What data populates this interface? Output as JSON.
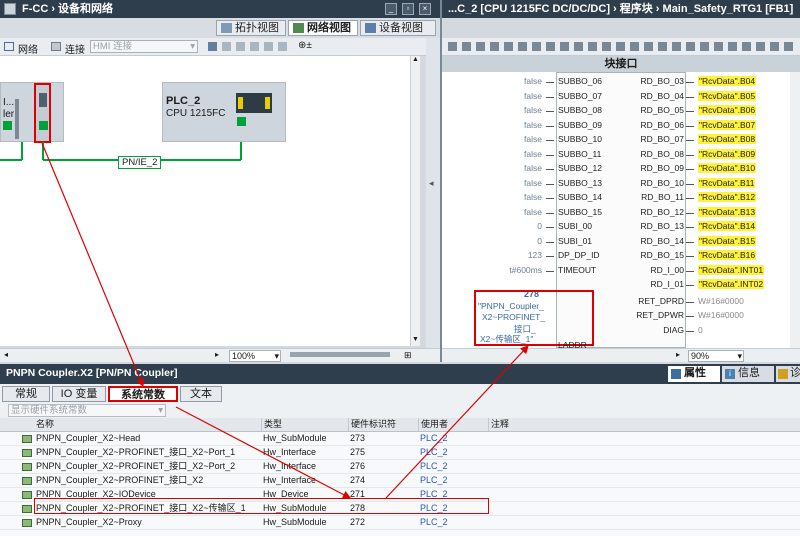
{
  "left_window": {
    "title": "F-CC  ›  设备和网络",
    "tabs": [
      "拓扑视图",
      "网络视图",
      "设备视图"
    ],
    "active_tab": "网络视图",
    "toolbar": {
      "network_label": "网络",
      "connect_label": "连接",
      "hmi_connect_placeholder": "HMI 连接"
    },
    "device_left": {
      "name_fragment": "I...",
      "type_fragment": "ler"
    },
    "device_plc": {
      "name": "PLC_2",
      "type": "CPU 1215FC"
    },
    "network_label": "PN/IE_2",
    "zoom": "100%"
  },
  "right_window": {
    "title": "...C_2 [CPU 1215FC DC/DC/DC]  ›  程序块  ›  Main_Safety_RTG1 [FB1]",
    "section_header": "块接口",
    "inputs": [
      {
        "value": "false",
        "pin": "SUBBO_06"
      },
      {
        "value": "false",
        "pin": "SUBBO_07"
      },
      {
        "value": "false",
        "pin": "SUBBO_08"
      },
      {
        "value": "false",
        "pin": "SUBBO_09"
      },
      {
        "value": "false",
        "pin": "SUBBO_10"
      },
      {
        "value": "false",
        "pin": "SUBBO_11"
      },
      {
        "value": "false",
        "pin": "SUBBO_12"
      },
      {
        "value": "false",
        "pin": "SUBBO_13"
      },
      {
        "value": "false",
        "pin": "SUBBO_14"
      },
      {
        "value": "false",
        "pin": "SUBBO_15"
      },
      {
        "value": "0",
        "pin": "SUBI_00"
      },
      {
        "value": "0",
        "pin": "SUBI_01"
      },
      {
        "value": "123",
        "pin": "DP_DP_ID"
      },
      {
        "value": "t#600ms",
        "pin": "TIMEOUT"
      }
    ],
    "laddr_value": "278",
    "laddr_tag": [
      "\"PNPN_Coupler_",
      "X2~PROFINET_",
      "接口_",
      "X2~传输区_1\""
    ],
    "laddr_pin": "LADDR",
    "outputs": [
      {
        "pin": "RD_BO_03",
        "value": "\"RcvData\".B04"
      },
      {
        "pin": "RD_BO_04",
        "value": "\"RcvData\".B05"
      },
      {
        "pin": "RD_BO_05",
        "value": "\"RcvData\".B06"
      },
      {
        "pin": "RD_BO_06",
        "value": "\"RcvData\".B07"
      },
      {
        "pin": "RD_BO_07",
        "value": "\"RcvData\".B08"
      },
      {
        "pin": "RD_BO_08",
        "value": "\"RcvData\".B09"
      },
      {
        "pin": "RD_BO_09",
        "value": "\"RcvData\".B10"
      },
      {
        "pin": "RD_BO_10",
        "value": "\"RcvData\".B11"
      },
      {
        "pin": "RD_BO_11",
        "value": "\"RcvData\".B12"
      },
      {
        "pin": "RD_BO_12",
        "value": "\"RcvData\".B13"
      },
      {
        "pin": "RD_BO_13",
        "value": "\"RcvData\".B14"
      },
      {
        "pin": "RD_BO_14",
        "value": "\"RcvData\".B15"
      },
      {
        "pin": "RD_BO_15",
        "value": "\"RcvData\".B16"
      },
      {
        "pin": "RD_I_00",
        "value": "\"RcvData\".INT01"
      },
      {
        "pin": "RD_I_01",
        "value": "\"RcvData\".INT02"
      }
    ],
    "extra_outputs": [
      {
        "pin": "RET_DPRD",
        "value": "W#16#0000"
      },
      {
        "pin": "RET_DPWR",
        "value": "W#16#0000"
      },
      {
        "pin": "DIAG",
        "value": "0"
      }
    ],
    "zoom": "90%"
  },
  "properties": {
    "title": "PNPN Coupler.X2 [PN/PN Coupler]",
    "right_tabs": [
      "属性",
      "信息",
      "诊"
    ],
    "tabs": [
      "常规",
      "IO 变量",
      "系统常数",
      "文本"
    ],
    "active_tab": "系统常数",
    "filter_placeholder": "显示硬件系统常数",
    "columns": [
      "名称",
      "类型",
      "硬件标识符",
      "使用者",
      "注释"
    ],
    "rows": [
      {
        "name": "PNPN_Coupler_X2~Head",
        "type": "Hw_SubModule",
        "hwid": "273",
        "user": "PLC_2"
      },
      {
        "name": "PNPN_Coupler_X2~PROFINET_接口_X2~Port_1",
        "type": "Hw_Interface",
        "hwid": "275",
        "user": "PLC_2"
      },
      {
        "name": "PNPN_Coupler_X2~PROFINET_接口_X2~Port_2",
        "type": "Hw_Interface",
        "hwid": "276",
        "user": "PLC_2"
      },
      {
        "name": "PNPN_Coupler_X2~PROFINET_接口_X2",
        "type": "Hw_Interface",
        "hwid": "274",
        "user": "PLC_2"
      },
      {
        "name": "PNPN_Coupler_X2~IODevice",
        "type": "Hw_Device",
        "hwid": "271",
        "user": "PLC_2"
      },
      {
        "name": "PNPN_Coupler_X2~PROFINET_接口_X2~传输区_1",
        "type": "Hw_SubModule",
        "hwid": "278",
        "user": "PLC_2"
      },
      {
        "name": "PNPN_Coupler_X2~Proxy",
        "type": "Hw_SubModule",
        "hwid": "272",
        "user": "PLC_2"
      }
    ],
    "highlight_row": 5
  },
  "colors": {
    "title_bg": "#2f3e4c",
    "accent_red": "#dd0000",
    "plc_green": "#00a03a",
    "tag_yellow": "#fff23a"
  }
}
